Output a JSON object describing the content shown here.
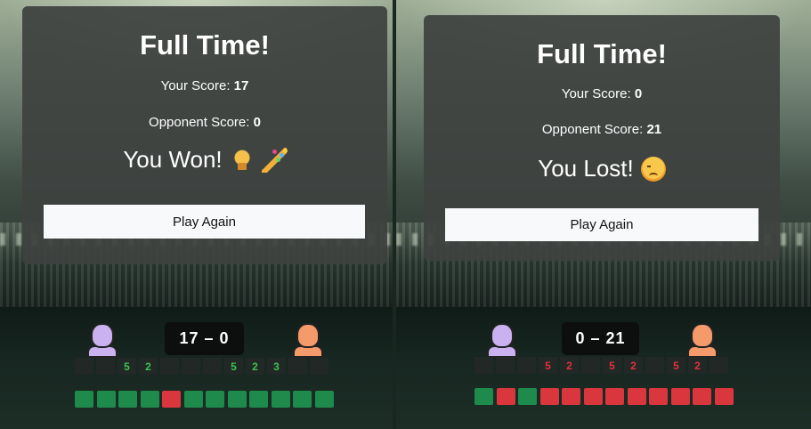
{
  "left": {
    "title": "Full Time!",
    "your_score_label": "Your Score:",
    "your_score": "17",
    "opponent_score_label": "Opponent Score:",
    "opponent_score": "0",
    "result": "You Won!",
    "result_icons": [
      "trophy-icon",
      "party-popper-icon"
    ],
    "button": "Play Again",
    "scoreboard": "17 – 0",
    "cells": [
      "",
      "",
      "5",
      "2",
      "",
      "",
      "",
      "5",
      "2",
      "3",
      "",
      ""
    ],
    "cell_colors": [
      "",
      "",
      "g",
      "g",
      "",
      "",
      "",
      "g",
      "g",
      "g",
      "",
      ""
    ],
    "dots": [
      "g",
      "g",
      "g",
      "g",
      "r",
      "g",
      "g",
      "g",
      "g",
      "g",
      "g",
      "g"
    ]
  },
  "right": {
    "title": "Full Time!",
    "your_score_label": "Your Score:",
    "your_score": "0",
    "opponent_score_label": "Opponent Score:",
    "opponent_score": "21",
    "result": "You Lost!",
    "result_icons": [
      "sad-face-icon"
    ],
    "button": "Play Again",
    "scoreboard": "0 – 21",
    "cells": [
      "",
      "",
      "",
      "5",
      "2",
      "",
      "5",
      "2",
      "",
      "5",
      "2",
      ""
    ],
    "cell_colors": [
      "",
      "",
      "",
      "r",
      "r",
      "",
      "r",
      "r",
      "",
      "r",
      "r",
      ""
    ],
    "dots": [
      "g",
      "r",
      "g",
      "r",
      "r",
      "r",
      "r",
      "r",
      "r",
      "r",
      "r",
      "r"
    ]
  },
  "colors": {
    "win": "#1e8a4c",
    "loss": "#d9363e",
    "win_text": "#3cc253",
    "loss_text": "#e0323a"
  }
}
